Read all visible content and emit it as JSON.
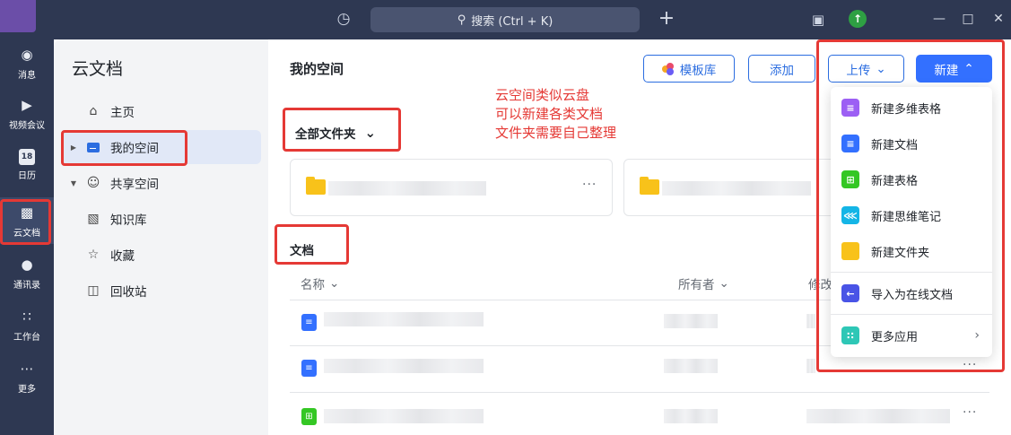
{
  "topbar": {
    "search_placeholder": "搜索 (Ctrl + K)",
    "history_icon": "clock-icon",
    "plus_label": "+",
    "upgrade_icon": "upgrade-arrow-icon"
  },
  "rail": {
    "items": [
      {
        "label": "消息",
        "icon": "chat-icon"
      },
      {
        "label": "视频会议",
        "icon": "camera-icon"
      },
      {
        "label": "日历",
        "icon": "calendar-icon",
        "badge": "18"
      },
      {
        "label": "云文档",
        "icon": "cloud-doc-icon"
      },
      {
        "label": "通讯录",
        "icon": "contacts-icon"
      },
      {
        "label": "工作台",
        "icon": "apps-icon"
      },
      {
        "label": "更多",
        "icon": "more-icon"
      }
    ]
  },
  "sidebar": {
    "title": "云文档",
    "items": [
      {
        "label": "主页",
        "icon": "home-icon"
      },
      {
        "label": "我的空间",
        "icon": "folder-icon"
      },
      {
        "label": "共享空间",
        "icon": "people-icon"
      },
      {
        "label": "知识库",
        "icon": "book-icon"
      },
      {
        "label": "收藏",
        "icon": "star-icon"
      },
      {
        "label": "回收站",
        "icon": "trash-icon"
      }
    ]
  },
  "main": {
    "title": "我的空间",
    "buttons": {
      "template": "模板库",
      "add": "添加",
      "upload": "上传",
      "create": "新建"
    },
    "folder_filter": "全部文件夹",
    "docs_section": "文档",
    "columns": {
      "name": "名称",
      "owner": "所有者",
      "modified": "修改"
    },
    "more_dots": "···"
  },
  "annotation": {
    "lines": [
      "云空间类似云盘",
      "可以新建各类文档",
      "文件夹需要自己整理"
    ]
  },
  "create_menu": {
    "items": [
      {
        "label": "新建多维表格",
        "icon": "bitable-icon",
        "color": "#9c5ff4"
      },
      {
        "label": "新建文档",
        "icon": "doc-icon",
        "color": "#3370ff"
      },
      {
        "label": "新建表格",
        "icon": "sheet-icon",
        "color": "#34c724"
      },
      {
        "label": "新建思维笔记",
        "icon": "mindnote-icon",
        "color": "#14b5e6"
      },
      {
        "label": "新建文件夹",
        "icon": "folder-icon",
        "color": "#f8c21a"
      },
      {
        "label": "导入为在线文档",
        "icon": "import-icon",
        "color": "#4954e6"
      },
      {
        "label": "更多应用",
        "icon": "more-apps-icon",
        "color": "#2ec7b6"
      }
    ]
  },
  "colors": {
    "accent": "#3370ff",
    "highlight_red": "#e53935",
    "nav_dark": "#2e3852"
  }
}
